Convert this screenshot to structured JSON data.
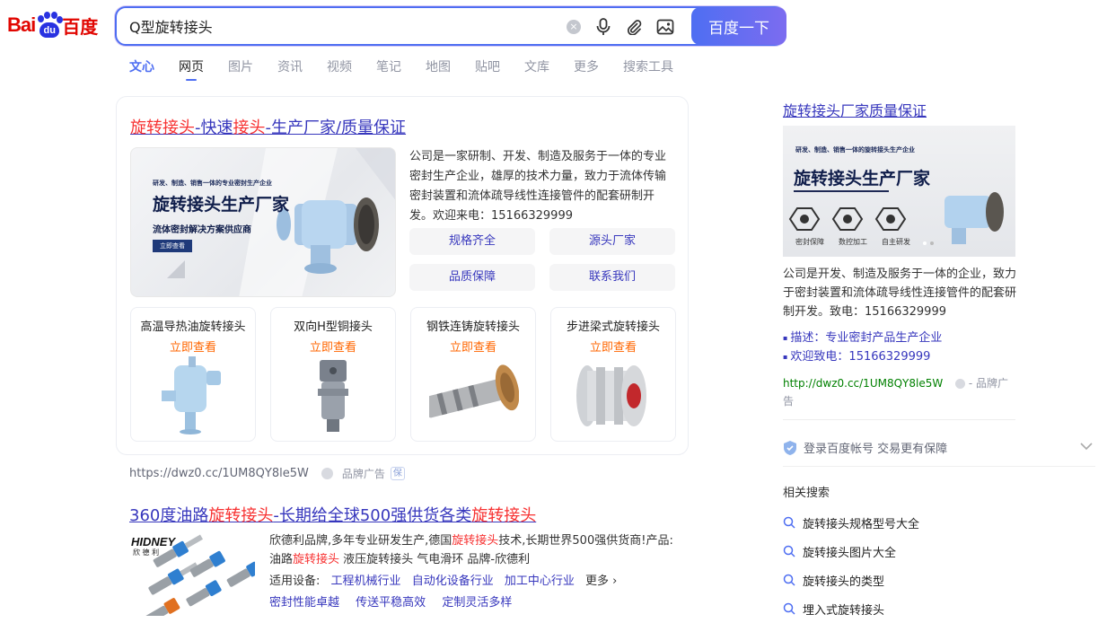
{
  "header": {
    "logo_bai": "Bai",
    "logo_du": "du",
    "logo_cn": "百度",
    "search_query": "Q型旋转接头",
    "search_button": "百度一下",
    "clear_glyph": "×"
  },
  "tabs": [
    {
      "label": "文心"
    },
    {
      "label": "网页"
    },
    {
      "label": "图片"
    },
    {
      "label": "资讯"
    },
    {
      "label": "视频"
    },
    {
      "label": "笔记"
    },
    {
      "label": "地图"
    },
    {
      "label": "贴吧"
    },
    {
      "label": "文库"
    },
    {
      "label": "更多"
    },
    {
      "label": "搜索工具"
    }
  ],
  "ad": {
    "title_parts": [
      "旋转接头",
      "-快速",
      "接头",
      "-生产厂家/质量保证"
    ],
    "description": "公司是一家研制、开发、制造及服务于一体的专业密封生产企业，雄厚的技术力量，致力于流体传输密封装置和流体疏导线性连接管件的配套研制开发。欢迎来电：15166329999",
    "banner_tagline": "研发、制造、销售一体的专业密封生产企业",
    "banner_heading": "旋转接头生产厂家",
    "banner_sub": "流体密封解决方案供应商",
    "banner_button": "立即查看",
    "sitelinks": [
      "规格齐全",
      "源头厂家",
      "品质保障",
      "联系我们"
    ],
    "products": [
      {
        "name": "高温导热油旋转接头",
        "cta": "立即查看"
      },
      {
        "name": "双向H型铜接头",
        "cta": "立即查看"
      },
      {
        "name": "钢铁连铸旋转接头",
        "cta": "立即查看"
      },
      {
        "name": "步进梁式旋转接头",
        "cta": "立即查看"
      }
    ],
    "url": "https://dwz0.cc/1UM8QY8le5W",
    "brand_label": "品牌广告",
    "bao_label": "保"
  },
  "result2": {
    "title_parts": [
      "360度油路",
      "旋转接头",
      "-长期给全球500强供货各类",
      "旋转接头"
    ],
    "desc_parts": [
      "欣德利品牌,多年专业研发生产,德国",
      "旋转接头",
      "技术,长期世界500强供货商!产品:油路",
      "旋转接头",
      " 液压旋转接头 气电滑环 品牌-欣德利"
    ],
    "equip_label": "适用设备:",
    "equip_links": [
      "工程机械行业",
      "自动化设备行业",
      "加工中心行业"
    ],
    "more": "更多",
    "features": [
      "密封性能卓越",
      "传送平稳高效",
      "定制灵活多样"
    ],
    "img_brand": "HIDNEY",
    "img_brand_cn": "欣 德 利"
  },
  "right": {
    "title": "旋转接头厂家质量保证",
    "banner_tagline": "研发、制造、销售一体的旋转接头生产企业",
    "banner_heading": "旋转接头生产厂家",
    "banner_icons": [
      "密封保障",
      "数控加工",
      "自主研发"
    ],
    "description": "公司是开发、制造及服务于一体的企业，致力于密封装置和流体疏导线性连接管件的配套研制开发。致电：15166329999",
    "bullets": [
      "描述：专业密封产品生产企业",
      "欢迎致电：15166329999"
    ],
    "url": "http://dwz0.cc/1UM8QY8le5W",
    "brand_label": " - 品牌广告",
    "login_text": "登录百度帐号 交易更有保障",
    "related_title": "相关搜索",
    "related": [
      "旋转接头规格型号大全",
      "旋转接头图片大全",
      "旋转接头的类型",
      "埋入式旋转接头"
    ]
  },
  "colors": {
    "brand_blue": "#4e6ef2",
    "link": "#3737bd",
    "highlight": "#f73131",
    "cta": "#ff6600",
    "url_green": "#008000"
  }
}
